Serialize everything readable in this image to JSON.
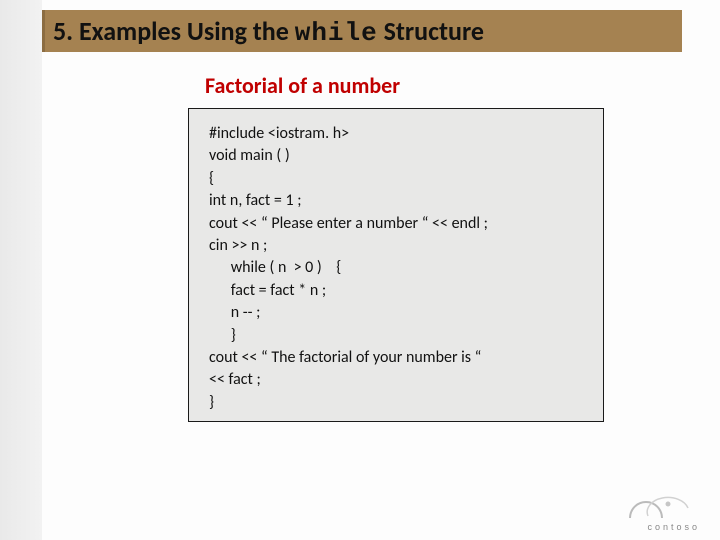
{
  "title": {
    "prefix": "5. Examples Using the ",
    "mono": "while",
    "suffix": "  Structure"
  },
  "subtitle": "Factorial of a number",
  "code": {
    "lines": [
      "#include <iostram. h>",
      "void main ( )",
      "{",
      "int n, fact = 1 ;",
      "cout << “ Please enter a number “ << endl ;",
      "cin >> n ;",
      "      while ( n  > 0 )    {",
      "      fact = fact * n ;",
      "      n -- ;",
      "      }",
      "cout << “ The factorial of your number is “",
      "<< fact ;",
      "}"
    ]
  },
  "logo": {
    "name": "contoso"
  }
}
